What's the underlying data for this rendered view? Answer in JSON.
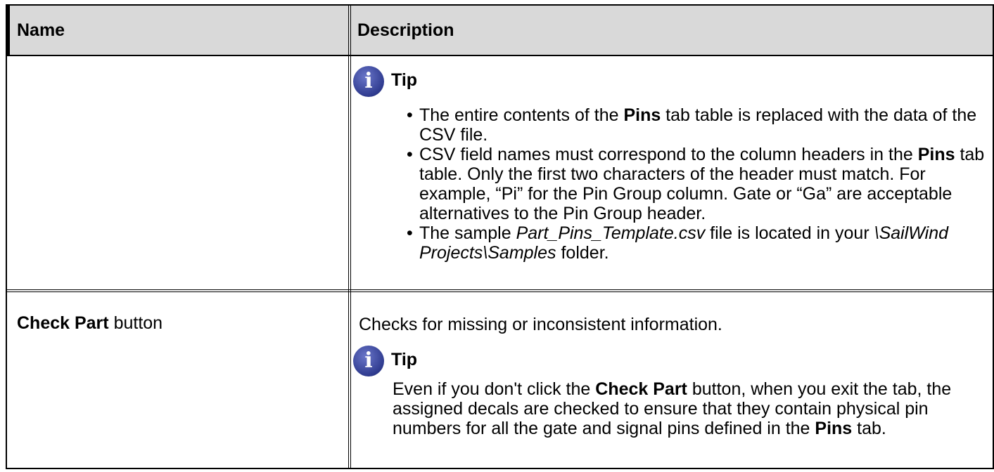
{
  "table": {
    "headers": [
      "Name",
      "Description"
    ],
    "row1": {
      "name": "",
      "tip_label": "Tip",
      "bullets": [
        {
          "pre": "The entire contents of the ",
          "bold": "Pins",
          "post": " tab table is replaced with the data of the CSV file."
        },
        {
          "pre": "CSV field names must correspond to the column headers in the ",
          "bold": "Pins",
          "post": " tab table. Only the first two characters of the header must match. For example, “Pi” for the Pin Group column. Gate or “Ga” are acceptable alternatives to the Pin Group header."
        },
        {
          "pre": "The sample ",
          "italic": "Part_Pins_Template.csv",
          "mid": " file is located in your ",
          "italic2": "\\SailWind Projects\\Samples",
          "post": " folder."
        }
      ]
    },
    "row2": {
      "name_bold": "Check Part",
      "name_rest": " button",
      "desc": "Checks for missing or inconsistent information.",
      "tip_label": "Tip",
      "tip_pre": "Even if you don't click the ",
      "tip_bold1": "Check Part",
      "tip_mid": " button, when you exit the tab, the assigned decals are checked to ensure that they contain physical pin numbers for all the gate and signal pins defined in the ",
      "tip_bold2": "Pins",
      "tip_post": " tab."
    }
  },
  "icons": {
    "tip": "info-icon",
    "tip_glyph": "i"
  },
  "colors": {
    "header_bg": "#d9d9d9",
    "icon": "#2f3b8f"
  }
}
